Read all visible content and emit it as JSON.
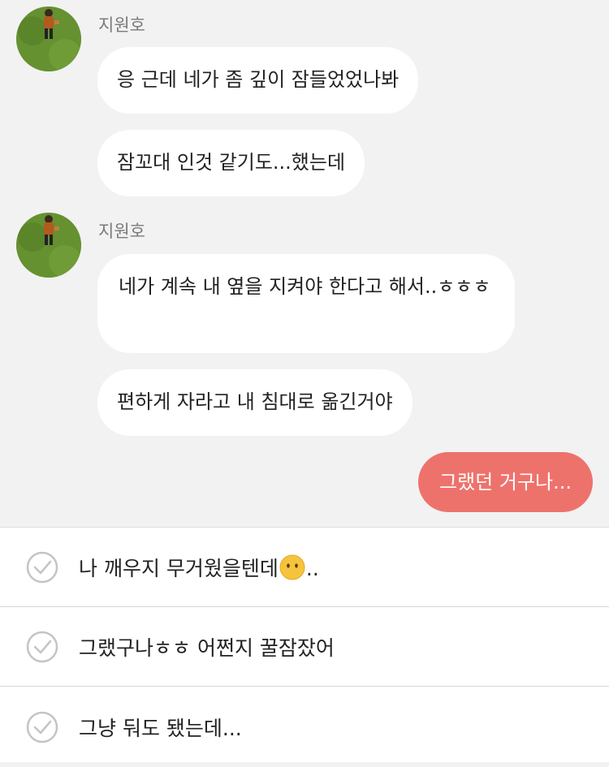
{
  "conversation": {
    "groups": [
      {
        "sender": "지원호",
        "messages": [
          "응 근데 네가 좀 깊이 잠들었었나봐",
          "잠꼬대 인것 같기도...했는데"
        ]
      },
      {
        "sender": "지원호",
        "messages": [
          "네가 계속 내 옆을 지켜야 한다고 해서..ㅎㅎㅎ",
          "편하게 자라고 내 침대로 옮긴거야"
        ]
      }
    ],
    "my_message": "그랬던 거구나..."
  },
  "reply_options": [
    {
      "text_before": "나 깨우지 무거웠을텐데",
      "emoji": "no-mouth-face-emoji",
      "text_after": ".."
    },
    {
      "text": "그랬구나ㅎㅎ 어쩐지 꿀잠잤어"
    },
    {
      "text": "그냥 둬도 됐는데..."
    }
  ],
  "colors": {
    "background": "#f2f2f2",
    "bubble_other": "#ffffff",
    "bubble_me": "#ee726c",
    "sender_text": "#7b7b7b",
    "check_icon": "#c4c4c4"
  }
}
